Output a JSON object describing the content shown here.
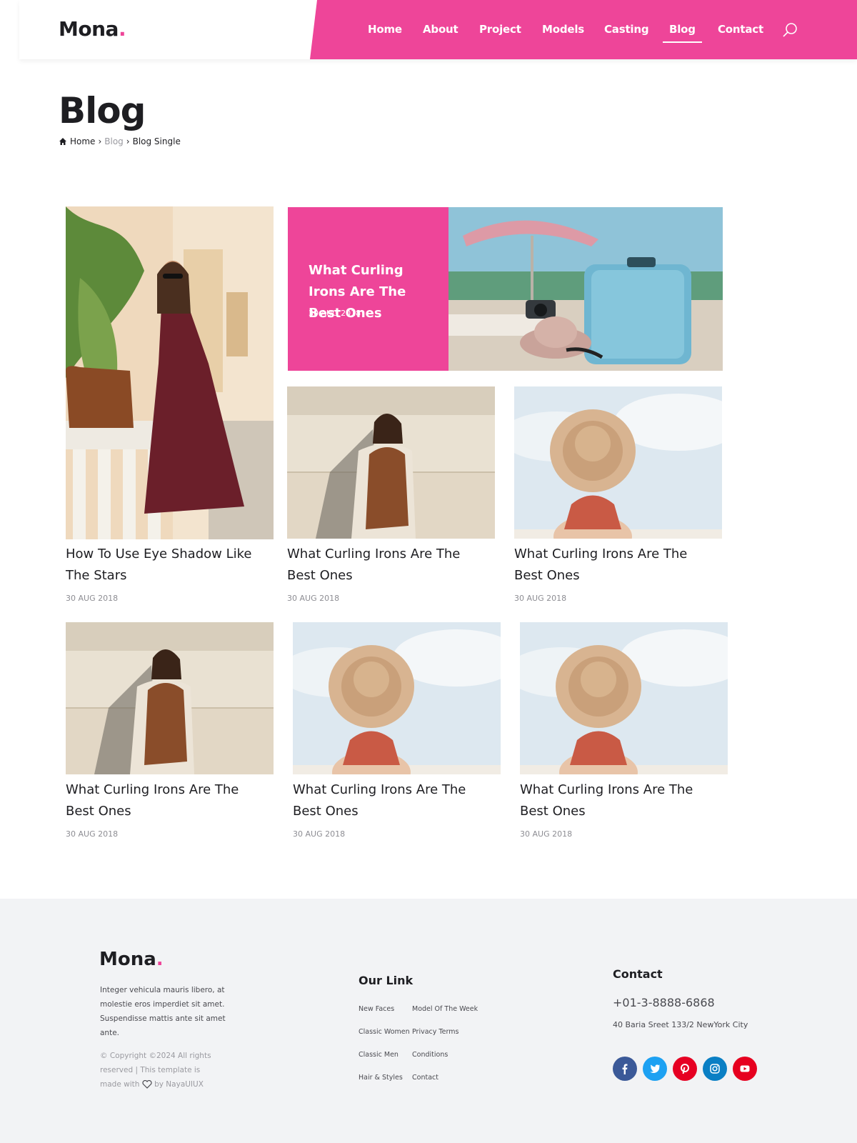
{
  "brand": {
    "name": "Mona",
    "dot": ".",
    "accent": "#ee4599"
  },
  "nav": {
    "items": [
      {
        "label": "Home"
      },
      {
        "label": "About"
      },
      {
        "label": "Project"
      },
      {
        "label": "Models"
      },
      {
        "label": "Casting"
      },
      {
        "label": "Blog",
        "active": true
      },
      {
        "label": "Contact"
      }
    ],
    "search_icon": "search-icon"
  },
  "page": {
    "title": "Blog",
    "breadcrumb": {
      "home": "Home",
      "blog": "Blog",
      "current": "Blog Single"
    }
  },
  "featured": {
    "title": "What Curling Irons Are The Best Ones",
    "date": "30 AUG 2018"
  },
  "posts": [
    {
      "title": "How To Use Eye Shadow Like The Stars",
      "date": "30 AUG 2018",
      "image": "woman in burgundy dress with brown handbag"
    },
    {
      "title": "What Curling Irons Are The Best Ones",
      "date": "30 AUG 2018",
      "image": "woman in polka dot dress against wall"
    },
    {
      "title": "What Curling Irons Are The Best Ones",
      "date": "30 AUG 2018",
      "image": "woman with straw hat under sky"
    },
    {
      "title": "What Curling Irons Are The Best Ones",
      "date": "30 AUG 2018",
      "image": "woman in polka dot dress against wall"
    },
    {
      "title": "What Curling Irons Are The Best Ones",
      "date": "30 AUG 2018",
      "image": "woman with straw hat under sky"
    },
    {
      "title": "What Curling Irons Are The Best Ones",
      "date": "30 AUG 2018",
      "image": "woman with straw hat under sky"
    }
  ],
  "footer": {
    "about": "Integer vehicula mauris libero, at molestie eros imperdiet sit amet. Suspendisse mattis ante sit amet ante.",
    "copyright_a": "© Copyright ©2024 All rights reserved | This template is made with",
    "copyright_b": "by NayaUIUX",
    "links_heading": "Our Link",
    "links": [
      "New Faces",
      "Model Of The Week",
      "Classic Women",
      "Privacy Terms",
      "Classic Men",
      "Conditions",
      "Hair & Styles",
      "Contact"
    ],
    "contact_heading": "Contact",
    "phone": "+01-3-8888-6868",
    "address": "40 Baria Sreet 133/2 NewYork City",
    "social": [
      {
        "icon": "facebook-icon",
        "color": "#3b5998"
      },
      {
        "icon": "twitter-icon",
        "color": "#1da1f2"
      },
      {
        "icon": "pinterest-icon",
        "color": "#e60023"
      },
      {
        "icon": "instagram-icon",
        "color": "#0a7fc4"
      },
      {
        "icon": "youtube-icon",
        "color": "#e6001f"
      }
    ]
  }
}
